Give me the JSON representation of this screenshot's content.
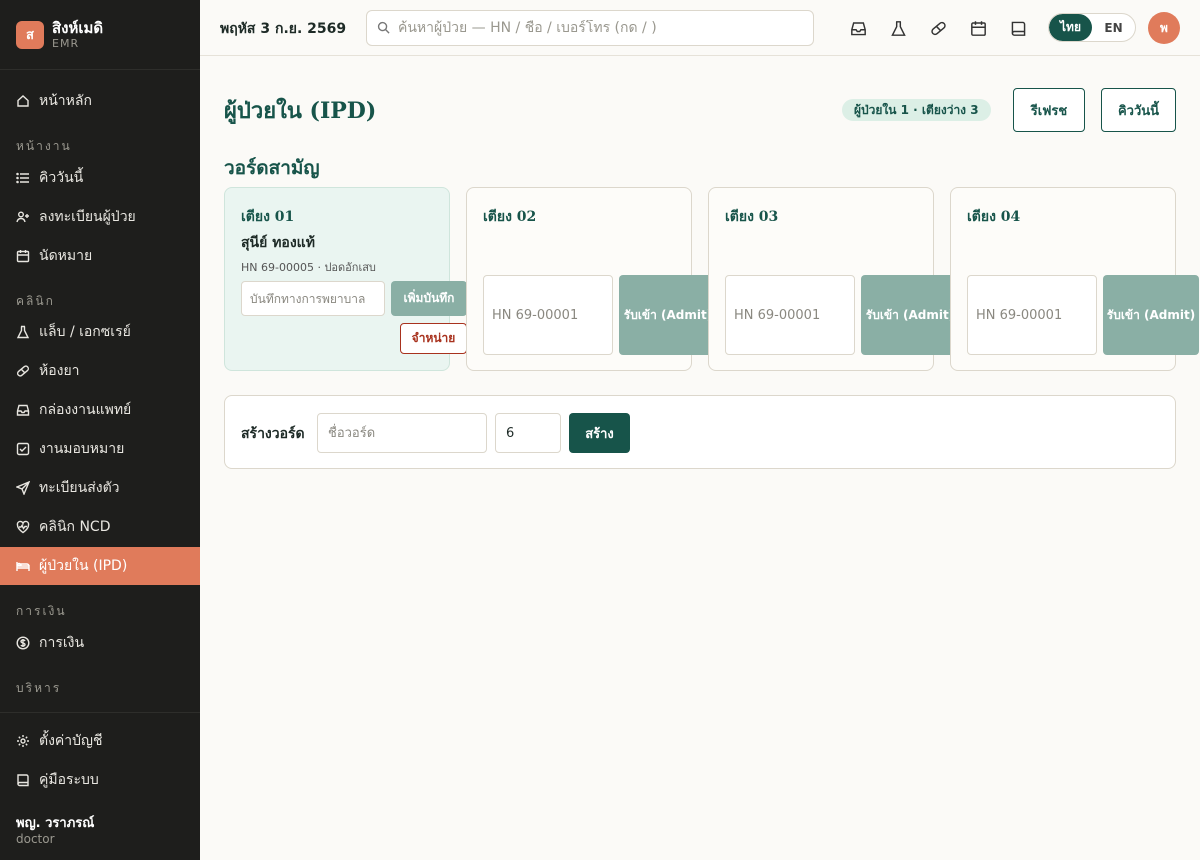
{
  "brand": {
    "logo_letter": "ส",
    "name": "สิงห์เมดิ",
    "sub": "EMR"
  },
  "sidebar": {
    "home": "หน้าหลัก",
    "sections": {
      "work": "หน้างาน",
      "clinic": "คลินิก",
      "finance": "การเงิน",
      "admin": "บริหาร"
    },
    "items": {
      "queue": "คิววันนี้",
      "register": "ลงทะเบียนผู้ป่วย",
      "appointments": "นัดหมาย",
      "lab": "แล็บ / เอกซเรย์",
      "pharmacy": "ห้องยา",
      "inbox": "กล่องงานแพทย์",
      "tasks": "งานมอบหมาย",
      "referral": "ทะเบียนส่งตัว",
      "ncd": "คลินิก NCD",
      "ipd": "ผู้ป่วยใน (IPD)",
      "billing": "การเงิน",
      "settings": "ตั้งค่าบัญชี",
      "manual": "คู่มือระบบ"
    },
    "user": {
      "name": "พญ. วราภรณ์",
      "role": "doctor"
    }
  },
  "topbar": {
    "date": "พฤหัส 3 ก.ย. 2569",
    "search_placeholder": "ค้นหาผู้ป่วย — HN / ชื่อ / เบอร์โทร (กด / )",
    "lang_th": "ไทย",
    "lang_en": "EN",
    "avatar_letter": "พ"
  },
  "main": {
    "title": "ผู้ป่วยใน (IPD)",
    "status_badge": "ผู้ป่วยใน 1 · เตียงว่าง 3",
    "refresh_label": "รีเฟรช",
    "queue_label": "คิววันนี้",
    "ward_title": "วอร์ดสามัญ",
    "beds": [
      {
        "label": "เตียง 01",
        "patient_name": "สุนีย์ ทองแท้",
        "patient_meta": "HN 69-00005 · ปอดอักเสบ",
        "note_placeholder": "บันทึกทางการพยาบาล",
        "note_button": "เพิ่มบันทึก",
        "discharge_button": "จำหน่าย"
      },
      {
        "label": "เตียง 02",
        "hn_placeholder": "HN 69-00001",
        "admit_button": "รับเข้า (Admit)"
      },
      {
        "label": "เตียง 03",
        "hn_placeholder": "HN 69-00001",
        "admit_button": "รับเข้า (Admit)"
      },
      {
        "label": "เตียง 04",
        "hn_placeholder": "HN 69-00001",
        "admit_button": "รับเข้า (Admit)"
      }
    ],
    "create_ward": {
      "label": "สร้างวอร์ด",
      "name_placeholder": "ชื่อวอร์ด",
      "bed_count_value": "6",
      "button": "สร้าง"
    }
  },
  "colors": {
    "accent": "#e07b5b",
    "primary": "#17544a",
    "sidebar_bg": "#1e1e1c",
    "danger": "#a8321e"
  }
}
